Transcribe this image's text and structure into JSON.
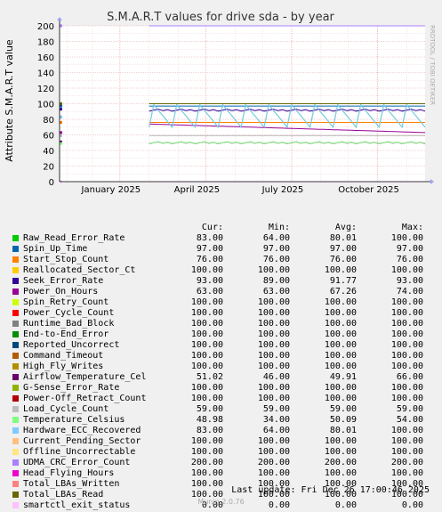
{
  "chart_data": {
    "type": "line",
    "title": "S.M.A.R.T values for drive sda - by year",
    "ylabel": "Attribute S.M.A.R.T value",
    "ylim": [
      0,
      200
    ],
    "yticks": [
      0,
      20,
      40,
      60,
      80,
      100,
      120,
      140,
      160,
      180,
      200
    ],
    "xtick_labels": [
      "January 2025",
      "April 2025",
      "July 2025",
      "October 2025"
    ],
    "side_label": "RRDTOOL / TOBI OETIKER",
    "grid": true,
    "legend_placement": "bottom",
    "columns": [
      "Cur:",
      "Min:",
      "Avg:",
      "Max:"
    ],
    "series": [
      {
        "name": "Raw_Read_Error_Rate",
        "color": "#00cc00",
        "cur": "83.00",
        "min": "64.00",
        "avg": "80.01",
        "max": "100.00"
      },
      {
        "name": "Spin_Up_Time",
        "color": "#0066b3",
        "cur": "97.00",
        "min": "97.00",
        "avg": "97.00",
        "max": "97.00"
      },
      {
        "name": "Start_Stop_Count",
        "color": "#ff8000",
        "cur": "76.00",
        "min": "76.00",
        "avg": "76.00",
        "max": "76.00"
      },
      {
        "name": "Reallocated_Sector_Ct",
        "color": "#ffcc00",
        "cur": "100.00",
        "min": "100.00",
        "avg": "100.00",
        "max": "100.00"
      },
      {
        "name": "Seek_Error_Rate",
        "color": "#330099",
        "cur": "93.00",
        "min": "89.00",
        "avg": "91.77",
        "max": "93.00"
      },
      {
        "name": "Power_On_Hours",
        "color": "#990099",
        "cur": "63.00",
        "min": "63.00",
        "avg": "67.26",
        "max": "74.00"
      },
      {
        "name": "Spin_Retry_Count",
        "color": "#ccff00",
        "cur": "100.00",
        "min": "100.00",
        "avg": "100.00",
        "max": "100.00"
      },
      {
        "name": "Power_Cycle_Count",
        "color": "#ff0000",
        "cur": "100.00",
        "min": "100.00",
        "avg": "100.00",
        "max": "100.00"
      },
      {
        "name": "Runtime_Bad_Block",
        "color": "#808080",
        "cur": "100.00",
        "min": "100.00",
        "avg": "100.00",
        "max": "100.00"
      },
      {
        "name": "End-to-End_Error",
        "color": "#008f00",
        "cur": "100.00",
        "min": "100.00",
        "avg": "100.00",
        "max": "100.00"
      },
      {
        "name": "Reported_Uncorrect",
        "color": "#00487d",
        "cur": "100.00",
        "min": "100.00",
        "avg": "100.00",
        "max": "100.00"
      },
      {
        "name": "Command_Timeout",
        "color": "#b35a00",
        "cur": "100.00",
        "min": "100.00",
        "avg": "100.00",
        "max": "100.00"
      },
      {
        "name": "High_Fly_Writes",
        "color": "#b38f00",
        "cur": "100.00",
        "min": "100.00",
        "avg": "100.00",
        "max": "100.00"
      },
      {
        "name": "Airflow_Temperature_Cel",
        "color": "#6b006b",
        "cur": "51.02",
        "min": "46.00",
        "avg": "49.91",
        "max": "66.00"
      },
      {
        "name": "G-Sense_Error_Rate",
        "color": "#8fb300",
        "cur": "100.00",
        "min": "100.00",
        "avg": "100.00",
        "max": "100.00"
      },
      {
        "name": "Power-Off_Retract_Count",
        "color": "#b30000",
        "cur": "100.00",
        "min": "100.00",
        "avg": "100.00",
        "max": "100.00"
      },
      {
        "name": "Load_Cycle_Count",
        "color": "#bebebe",
        "cur": "59.00",
        "min": "59.00",
        "avg": "59.00",
        "max": "59.00"
      },
      {
        "name": "Temperature_Celsius",
        "color": "#80ff80",
        "cur": "48.98",
        "min": "34.00",
        "avg": "50.09",
        "max": "54.00"
      },
      {
        "name": "Hardware_ECC_Recovered",
        "color": "#80c9ff",
        "cur": "83.00",
        "min": "64.00",
        "avg": "80.01",
        "max": "100.00"
      },
      {
        "name": "Current_Pending_Sector",
        "color": "#ffc080",
        "cur": "100.00",
        "min": "100.00",
        "avg": "100.00",
        "max": "100.00"
      },
      {
        "name": "Offline_Uncorrectable",
        "color": "#ffe680",
        "cur": "100.00",
        "min": "100.00",
        "avg": "100.00",
        "max": "100.00"
      },
      {
        "name": "UDMA_CRC_Error_Count",
        "color": "#aa80ff",
        "cur": "200.00",
        "min": "200.00",
        "avg": "200.00",
        "max": "200.00"
      },
      {
        "name": "Head_Flying_Hours",
        "color": "#ee00cc",
        "cur": "100.00",
        "min": "100.00",
        "avg": "100.00",
        "max": "100.00"
      },
      {
        "name": "Total_LBAs_Written",
        "color": "#ff8080",
        "cur": "100.00",
        "min": "100.00",
        "avg": "100.00",
        "max": "100.00"
      },
      {
        "name": "Total_LBAs_Read",
        "color": "#666600",
        "cur": "100.00",
        "min": "100.00",
        "avg": "100.00",
        "max": "100.00"
      },
      {
        "name": "smartctl_exit_status",
        "color": "#ffbfff",
        "cur": "0.00",
        "min": "0.00",
        "avg": "0.00",
        "max": "0.00"
      }
    ]
  },
  "last_update": "Last update: Fri Dec 26 17:00:46 2025",
  "footer": "Munin 2.0.76"
}
